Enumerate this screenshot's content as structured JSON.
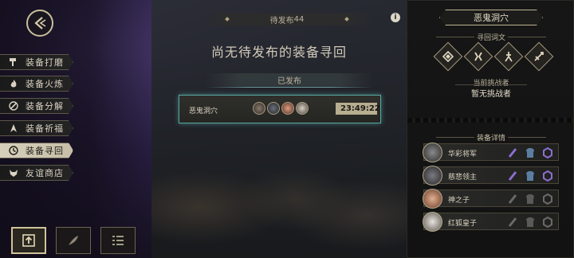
{
  "header": {
    "pending_label": "待发布",
    "pending_count": "44",
    "info_icon": "i"
  },
  "main": {
    "empty_message": "尚无待发布的装备寻回",
    "published_label": "已发布",
    "published_entry": {
      "title": "恶鬼洞穴",
      "timer": "23:49:22"
    }
  },
  "menu": {
    "items": [
      {
        "label": "装备打磨",
        "icon": "hammer-icon",
        "active": false
      },
      {
        "label": "装备火炼",
        "icon": "flame-icon",
        "active": false
      },
      {
        "label": "装备分解",
        "icon": "disassemble-icon",
        "active": false
      },
      {
        "label": "装备祈福",
        "icon": "blessing-icon",
        "active": false
      },
      {
        "label": "装备寻回",
        "icon": "retrieve-icon",
        "active": true
      },
      {
        "label": "友谊商店",
        "icon": "fox-shop-icon",
        "active": false
      }
    ]
  },
  "bottom_bar": {
    "buttons": [
      {
        "icon": "upload-icon",
        "active": true
      },
      {
        "icon": "feather-icon",
        "active": false
      },
      {
        "icon": "list-icon",
        "active": false
      }
    ]
  },
  "right_panel": {
    "title": "恶鬼洞穴",
    "affix_label": "寻回词文",
    "challenger_label": "当前挑战者",
    "challenger_value": "暂无挑战者",
    "equip_label": "装备详情",
    "equipment": [
      {
        "name": "华彩将军"
      },
      {
        "name": "慈悲领主"
      },
      {
        "name": "神之子"
      },
      {
        "name": "红狐皇子"
      }
    ]
  },
  "colors": {
    "accent_teal": "#58a9a2",
    "gold": "#c9bf9c",
    "slot_purple": "#7a5fc0",
    "slot_blue": "#5b7ea0",
    "slot_gray": "#6a6a6a"
  }
}
